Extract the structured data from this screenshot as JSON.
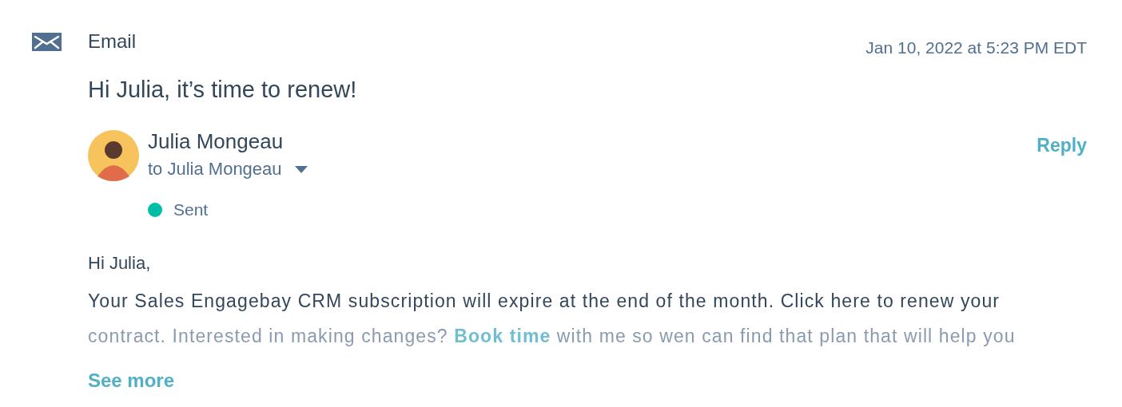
{
  "activity": {
    "type": "Email",
    "timestamp": "Jan 10, 2022 at 5:23 PM EDT"
  },
  "subject": "Hi Julia, it’s time to renew!",
  "sender": {
    "name": "Julia Mongeau",
    "recipient": "to Julia Mongeau",
    "expanded": false
  },
  "reply": "Reply",
  "status": {
    "label": "Sent",
    "color": "#00bda5"
  },
  "greeting": "Hi Julia,",
  "body_lines": [
    [
      {
        "kind": "text",
        "text": "Your Sales Engagebay CRM subscription will expire at the end of the month. Click here to renew your"
      }
    ],
    [
      {
        "kind": "text",
        "text": "contract. Interested in making changes? "
      },
      {
        "kind": "link",
        "text": "Book time"
      },
      {
        "kind": "text",
        "text": " with me so wen can find that plan that will help you"
      }
    ]
  ],
  "see_more": "See more"
}
